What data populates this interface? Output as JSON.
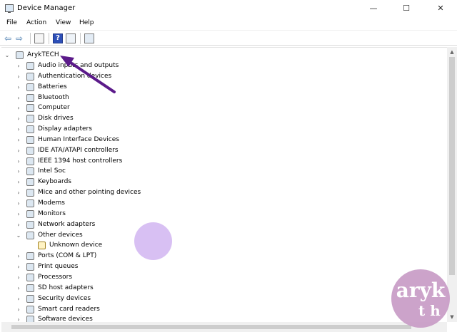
{
  "window": {
    "title": "Device Manager",
    "min_glyph": "—",
    "max_glyph": "☐",
    "close_glyph": "✕"
  },
  "menu": [
    "File",
    "Action",
    "View",
    "Help"
  ],
  "toolbar": {
    "back_glyph": "⇦",
    "forward_glyph": "⇨",
    "help_glyph": "?"
  },
  "tree": {
    "root": {
      "label": "ArykTECH",
      "expanded": true,
      "icon": "computer-icon"
    },
    "items": [
      {
        "label": "Audio inputs and outputs",
        "icon": "speaker-icon",
        "expanded": false
      },
      {
        "label": "Authentication devices",
        "icon": "fingerprint-icon",
        "expanded": false
      },
      {
        "label": "Batteries",
        "icon": "battery-icon",
        "expanded": false
      },
      {
        "label": "Bluetooth",
        "icon": "bluetooth-icon",
        "expanded": false
      },
      {
        "label": "Computer",
        "icon": "monitor-icon",
        "expanded": false
      },
      {
        "label": "Disk drives",
        "icon": "disk-icon",
        "expanded": false
      },
      {
        "label": "Display adapters",
        "icon": "display-adapter-icon",
        "expanded": false
      },
      {
        "label": "Human Interface Devices",
        "icon": "hid-icon",
        "expanded": false
      },
      {
        "label": "IDE ATA/ATAPI controllers",
        "icon": "ide-icon",
        "expanded": false
      },
      {
        "label": "IEEE 1394 host controllers",
        "icon": "firewire-icon",
        "expanded": false
      },
      {
        "label": "Intel Soc",
        "icon": "chip-icon",
        "expanded": false
      },
      {
        "label": "Keyboards",
        "icon": "keyboard-icon",
        "expanded": false
      },
      {
        "label": "Mice and other pointing devices",
        "icon": "mouse-icon",
        "expanded": false
      },
      {
        "label": "Modems",
        "icon": "modem-icon",
        "expanded": false
      },
      {
        "label": "Monitors",
        "icon": "monitor-icon",
        "expanded": false
      },
      {
        "label": "Network adapters",
        "icon": "network-icon",
        "expanded": false
      },
      {
        "label": "Other devices",
        "icon": "unknown-device-icon",
        "expanded": true,
        "children": [
          {
            "label": "Unknown device",
            "icon": "warning-device-icon"
          }
        ]
      },
      {
        "label": "Ports (COM & LPT)",
        "icon": "port-icon",
        "expanded": false
      },
      {
        "label": "Print queues",
        "icon": "printer-icon",
        "expanded": false
      },
      {
        "label": "Processors",
        "icon": "processor-icon",
        "expanded": false
      },
      {
        "label": "SD host adapters",
        "icon": "sd-card-icon",
        "expanded": false
      },
      {
        "label": "Security devices",
        "icon": "security-icon",
        "expanded": false
      },
      {
        "label": "Smart card readers",
        "icon": "smart-card-icon",
        "expanded": false
      },
      {
        "label": "Software devices",
        "icon": "software-icon",
        "expanded": false
      }
    ]
  },
  "annotation": {
    "arrow_color": "#5b1a8a"
  },
  "watermark": {
    "text": "aryk",
    "sub": "t h",
    "color": "#c79ac5"
  }
}
